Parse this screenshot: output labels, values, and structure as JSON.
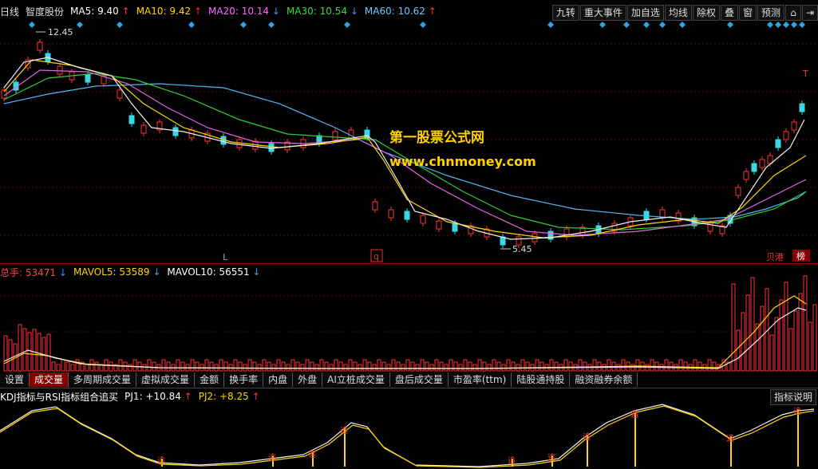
{
  "main": {
    "period": "日线",
    "stock_name": "智度股份",
    "ma": [
      {
        "label": "MA5: 9.40",
        "arrow": "↑",
        "color": "#ffffff"
      },
      {
        "label": "MA10: 9.42",
        "arrow": "↑",
        "color": "#ffd700"
      },
      {
        "label": "MA20: 10.14",
        "arrow": "↓",
        "color": "#ff66ff"
      },
      {
        "label": "MA30: 10.54",
        "arrow": "↓",
        "color": "#33dd33"
      },
      {
        "label": "MA60: 10.62",
        "arrow": "↑",
        "color": "#66ccff"
      }
    ],
    "high_label": "12.45",
    "low_label": "5.45",
    "marker_l": "L",
    "marker_q": "q",
    "marker_t": "T",
    "badge_beigang": "贝港",
    "badge_bang": "榜"
  },
  "toolbar": {
    "jiuzhuan": "九转",
    "zhongda": "重大事件",
    "jiazixuan": "加自选",
    "junxian": "均线",
    "chuquan": "除权",
    "die": "叠",
    "chuang": "窗",
    "yuce": "预测"
  },
  "watermark": {
    "line1": "第一股票公式网",
    "line2": "www.chnmoney.com"
  },
  "volume": {
    "total": {
      "label": "总手: 53471",
      "arrow": "↓"
    },
    "mavol5": {
      "label": "MAVOL5: 53589",
      "arrow": "↓"
    },
    "mavol10": {
      "label": "MAVOL10: 56551",
      "arrow": "↓"
    }
  },
  "tabs": [
    {
      "label": "设置",
      "active": false
    },
    {
      "label": "成交量",
      "active": true
    },
    {
      "label": "多周期成交量",
      "active": false
    },
    {
      "label": "虚拟成交量",
      "active": false
    },
    {
      "label": "金额",
      "active": false
    },
    {
      "label": "换手率",
      "active": false
    },
    {
      "label": "内盘",
      "active": false
    },
    {
      "label": "外盘",
      "active": false
    },
    {
      "label": "AI立桩成交量",
      "active": false
    },
    {
      "label": "盘后成交量",
      "active": false
    },
    {
      "label": "市盈率(ttm)",
      "active": false
    },
    {
      "label": "陆股通持股",
      "active": false
    },
    {
      "label": "融资融券余额",
      "active": false
    }
  ],
  "indicator": {
    "title": "KDJ指标与RSI指标组合追买",
    "pj1": "PJ1: +10.84",
    "pj1_arrow": "↑",
    "pj2": "PJ2: +8.25",
    "pj2_arrow": "↑",
    "explain_button": "指标说明",
    "signal_label": "追"
  }
}
